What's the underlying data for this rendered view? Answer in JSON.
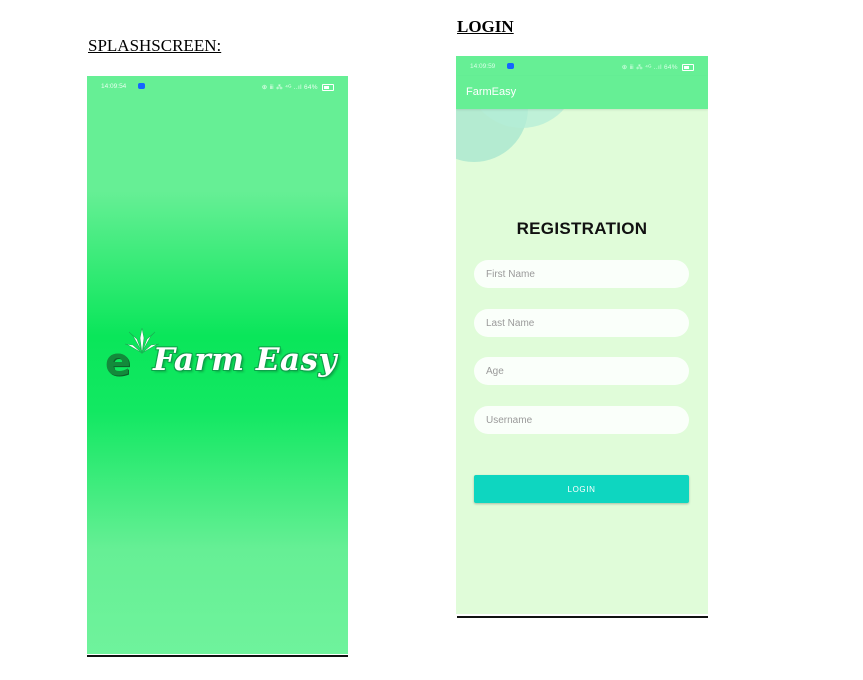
{
  "captions": {
    "splash": "SPLASHSCREEN:",
    "login": "LOGIN"
  },
  "splash_screen": {
    "status_time": "14:09:54",
    "status_right": "⊕ ⅲ ⁂ ⁴ᴳ ..ıl 64%",
    "logo_letter": "e",
    "logo_text": "Farm Easy"
  },
  "login_screen": {
    "status_time": "14:09:59",
    "status_right": "⊕ ⅲ ⁂ ⁴ᴳ ..ıl 64%",
    "app_title": "FarmEasy",
    "heading": "REGISTRATION",
    "fields": {
      "first_name": "First Name",
      "last_name": "Last Name",
      "age": "Age",
      "username": "Username"
    },
    "button_label": "LOGIN"
  },
  "colors": {
    "splash_green": "#0ae65a",
    "appbar_green": "#66ef95",
    "screen_bg": "#e0fcd9",
    "button_teal": "#0ed6c0"
  }
}
